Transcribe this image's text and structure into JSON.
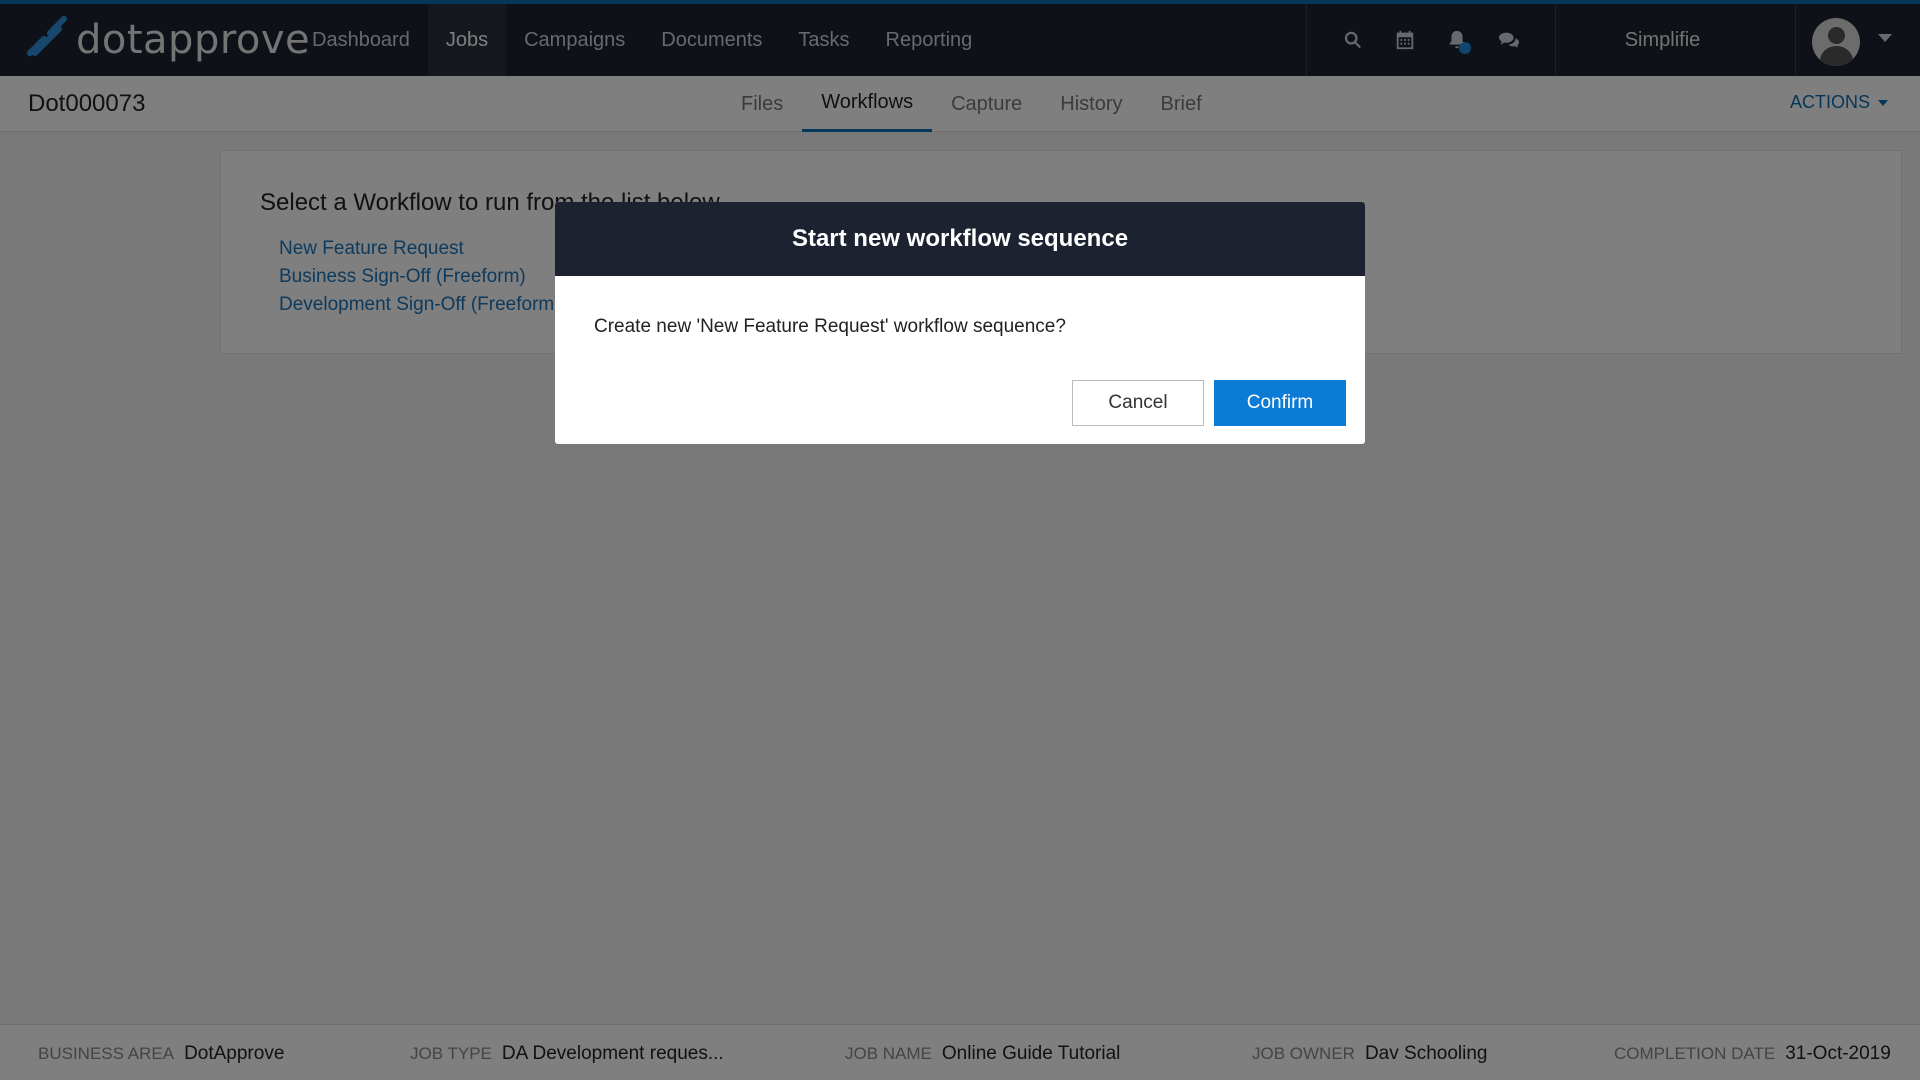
{
  "app": {
    "logo_text": "dotapprove"
  },
  "topnav": {
    "items": [
      {
        "label": "Dashboard",
        "active": false
      },
      {
        "label": "Jobs",
        "active": true
      },
      {
        "label": "Campaigns",
        "active": false
      },
      {
        "label": "Documents",
        "active": false
      },
      {
        "label": "Tasks",
        "active": false
      },
      {
        "label": "Reporting",
        "active": false
      }
    ],
    "icons": [
      "search-icon",
      "calendar-icon",
      "bell-icon",
      "chat-icon"
    ],
    "user_name": "Simplifie"
  },
  "subheader": {
    "job_id": "Dot000073",
    "tabs": [
      {
        "label": "Files",
        "active": false
      },
      {
        "label": "Workflows",
        "active": true
      },
      {
        "label": "Capture",
        "active": false
      },
      {
        "label": "History",
        "active": false
      },
      {
        "label": "Brief",
        "active": false
      }
    ],
    "actions_label": "ACTIONS"
  },
  "main": {
    "title": "Select a Workflow to run from the list below",
    "workflows": [
      "New Feature Request",
      "Business Sign-Off (Freeform)",
      "Development Sign-Off (Freeform)"
    ]
  },
  "modal": {
    "title": "Start new workflow sequence",
    "message": "Create new 'New Feature Request' workflow sequence?",
    "cancel_label": "Cancel",
    "confirm_label": "Confirm"
  },
  "footer": {
    "business_area_label": "BUSINESS AREA",
    "business_area": "DotApprove",
    "job_type_label": "JOB TYPE",
    "job_type": "DA Development reques...",
    "job_name_label": "JOB NAME",
    "job_name": "Online Guide Tutorial",
    "job_owner_label": "JOB OWNER",
    "job_owner": "Dav Schooling",
    "completion_date_label": "COMPLETION DATE",
    "completion_date": "31-Oct-2019"
  },
  "colors": {
    "nav_bg": "#1c2230",
    "accent": "#0a6fb5",
    "confirm_button": "#0c7bd6",
    "link": "#1a75bb"
  }
}
